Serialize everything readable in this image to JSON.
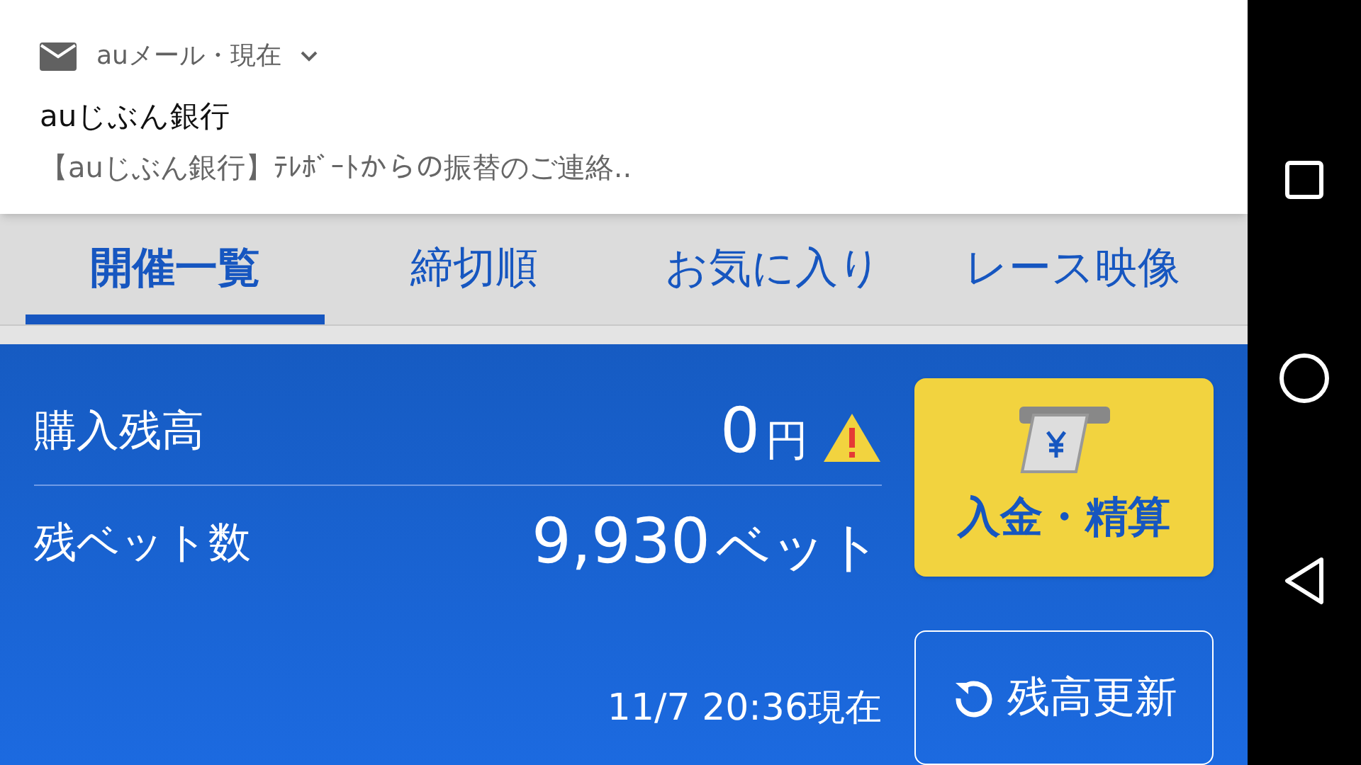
{
  "notification": {
    "app": "auメール・現在",
    "title": "auじぶん銀行",
    "body": "【auじぶん銀行】ﾃﾚﾎﾞｰﾄからの振替のご連絡.."
  },
  "tabs": [
    {
      "label": "開催一覧",
      "selected": true
    },
    {
      "label": "締切順",
      "selected": false
    },
    {
      "label": "お気に入り",
      "selected": false
    },
    {
      "label": "レース映像",
      "selected": false
    }
  ],
  "balance": {
    "rows": [
      {
        "label": "購入残高",
        "amount": "0",
        "unit": "円",
        "warning": true
      },
      {
        "label": "残ベット数",
        "amount": "9,930",
        "unit": "ベット",
        "warning": false
      }
    ],
    "deposit_button": "入金・精算",
    "timestamp": "11/7 20:36現在",
    "refresh_button": "残高更新"
  }
}
